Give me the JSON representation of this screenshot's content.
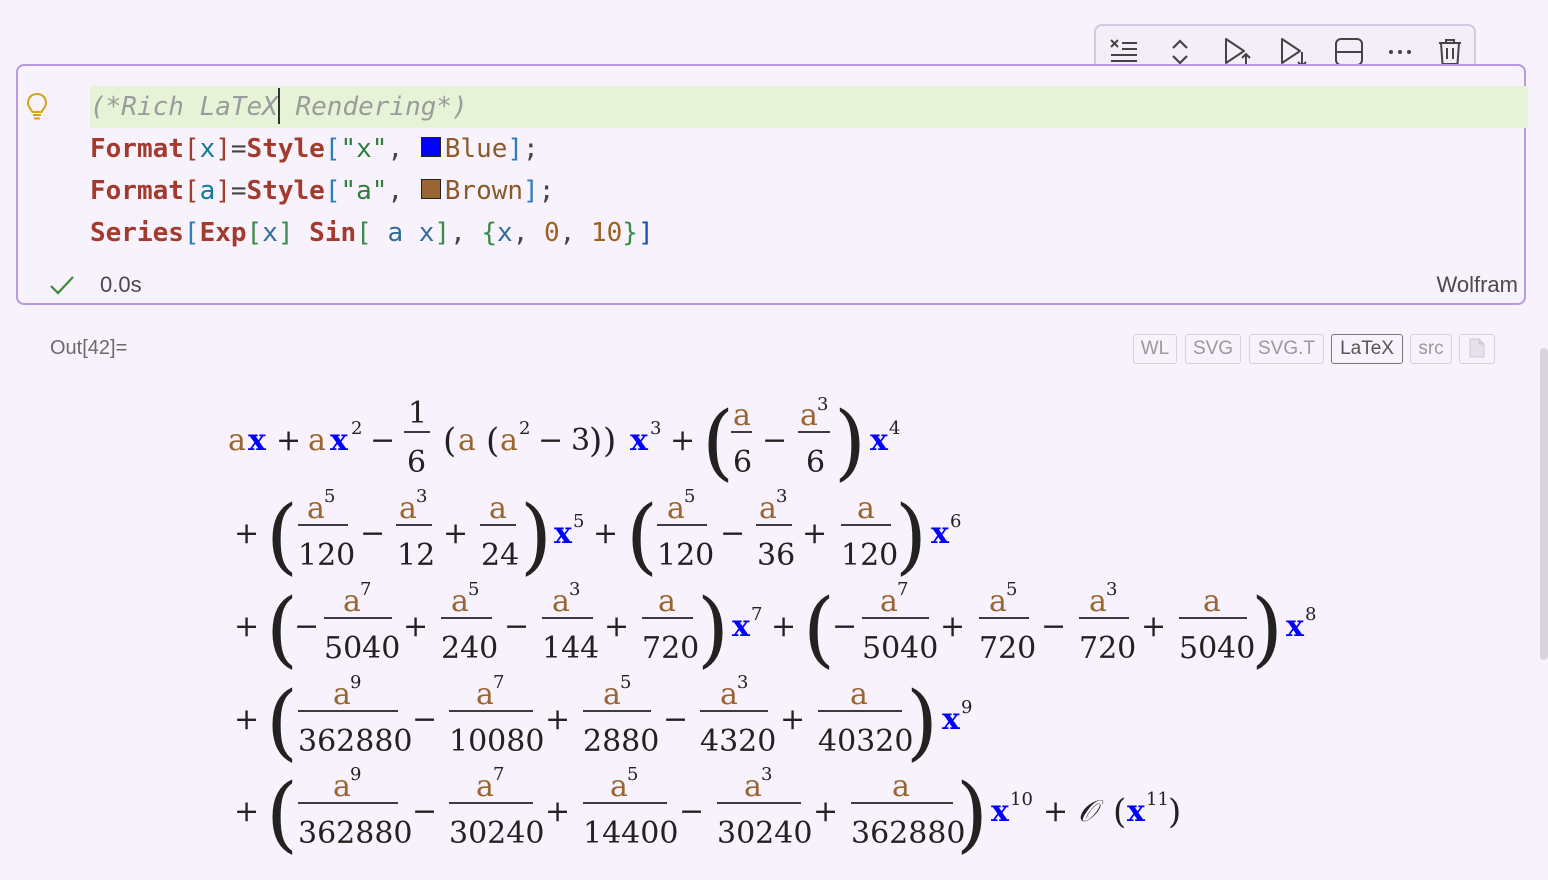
{
  "cell": {
    "code_lines": [
      "(*Rich LaTeX Rendering*)",
      "Format[x]=Style[\"x\", Blue];",
      "Format[a]=Style[\"a\", Brown];",
      "Series[Exp[x] Sin[ a x], {x, 0, 10}]"
    ],
    "comment_left": "(*Rich LaTeX",
    "comment_right": " Rendering*)",
    "tokens": {
      "format": "Format",
      "style": "Style",
      "series": "Series",
      "exp": "Exp",
      "sin": "Sin",
      "x": "x",
      "a": "a",
      "str_x": "\"x\"",
      "str_a": "\"a\"",
      "blue": "Blue",
      "brown": "Brown",
      "zero": "0",
      "ten": "10"
    },
    "status_time": "0.0s",
    "language": "Wolfram"
  },
  "colors": {
    "blue_swatch": "#0000ff",
    "brown_swatch": "#996633",
    "math_blue": "#0000ff",
    "math_brown": "#996633",
    "cell_border": "#b79ae0"
  },
  "toolbar": {
    "icons": [
      "clear-output-icon",
      "collapse-expand-icon",
      "run-above-icon",
      "run-below-icon",
      "split-cell-icon",
      "more-icon",
      "delete-icon"
    ]
  },
  "output": {
    "label": "Out[42]=",
    "formats": [
      "WL",
      "SVG",
      "SVG.T",
      "LaTeX",
      "src"
    ],
    "active_format": "LaTeX"
  }
}
